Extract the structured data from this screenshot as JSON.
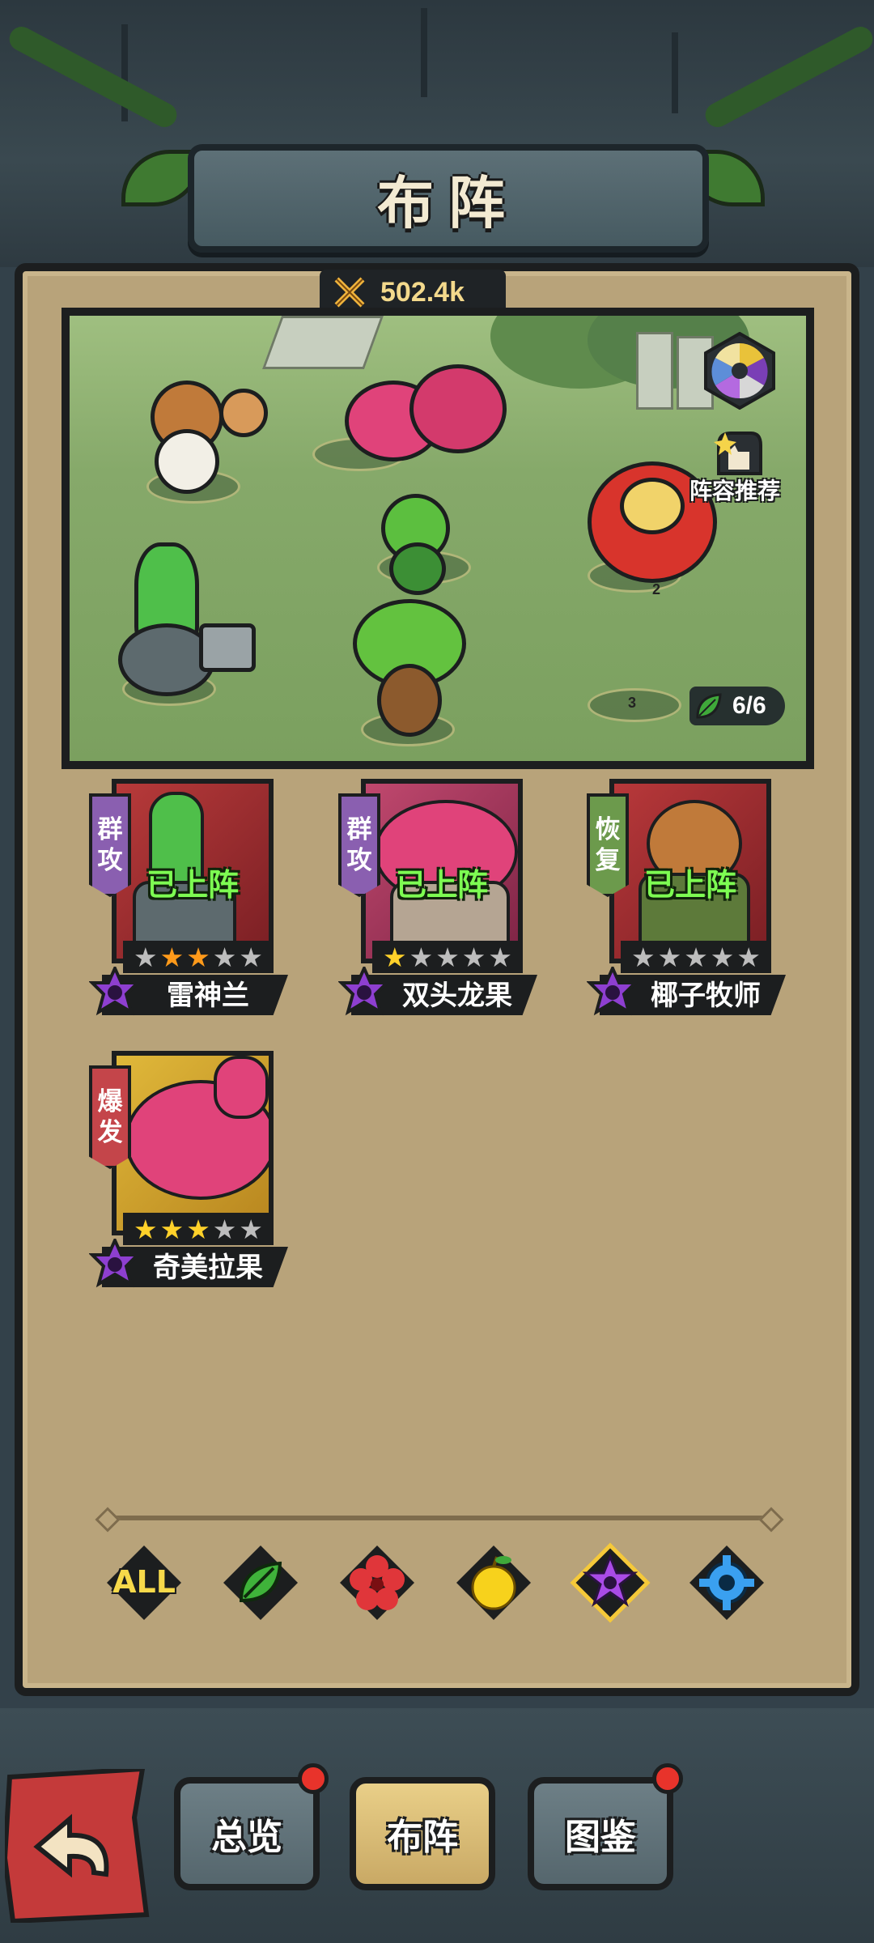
{
  "header": {
    "title": "布阵"
  },
  "power": {
    "value": "502.4k",
    "icon": "crossed-swords-icon"
  },
  "field": {
    "recommend_label": "阵容推荐",
    "slot_numbers": [
      "2",
      "3"
    ],
    "team_count": "6/6"
  },
  "cards": [
    {
      "role": "群攻",
      "status": "已上阵",
      "name": "雷神兰",
      "stars": [
        "gray",
        "orange",
        "orange",
        "gray",
        "gray"
      ],
      "role_color": "#8a5fb0"
    },
    {
      "role": "群攻",
      "status": "已上阵",
      "name": "双头龙果",
      "stars": [
        "gold",
        "gray",
        "gray",
        "gray",
        "gray"
      ],
      "role_color": "#8a5fb0"
    },
    {
      "role": "恢复",
      "status": "已上阵",
      "name": "椰子牧师",
      "stars": [
        "gray",
        "gray",
        "gray",
        "gray",
        "gray"
      ],
      "role_color": "#6c9a4c"
    },
    {
      "role": "爆发",
      "status": "",
      "name": "奇美拉果",
      "stars": [
        "gold",
        "gold",
        "gold",
        "gray",
        "gray"
      ],
      "role_color": "#c4454a"
    }
  ],
  "filters": {
    "all_label": "ALL",
    "items": [
      "all",
      "nature-leaf-icon",
      "red-flower-icon",
      "yellow-fruit-icon",
      "purple-star-icon",
      "blue-gear-icon"
    ],
    "selected": "purple-star-icon"
  },
  "nav": {
    "tabs": [
      "总览",
      "布阵",
      "图鉴"
    ],
    "active": "布阵"
  },
  "colors": {
    "parchment": "#b8a37a",
    "status_green": "#7dfc52",
    "active_tab": "#e9cf88",
    "notification_red": "#e8332b"
  }
}
